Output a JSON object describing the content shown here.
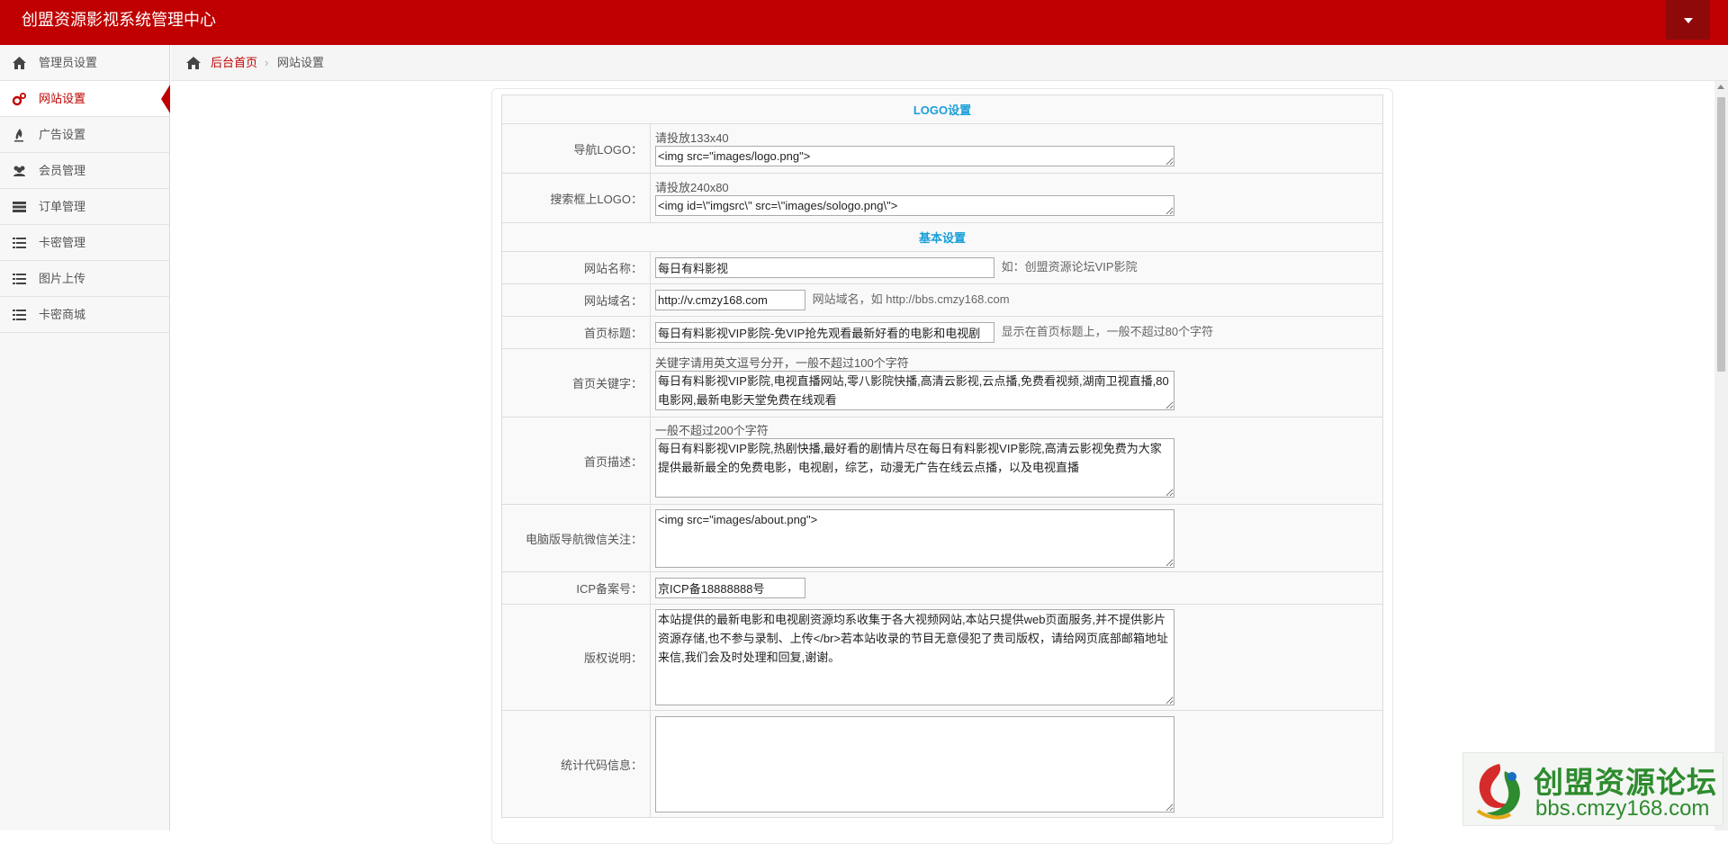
{
  "app": {
    "title": "创盟资源影视系统管理中心"
  },
  "sidebar": {
    "items": [
      {
        "label": "管理员设置",
        "icon": "home-icon"
      },
      {
        "label": "网站设置",
        "icon": "gears-icon",
        "active": true
      },
      {
        "label": "广告设置",
        "icon": "fire-icon"
      },
      {
        "label": "会员管理",
        "icon": "users-icon"
      },
      {
        "label": "订单管理",
        "icon": "server-icon"
      },
      {
        "label": "卡密管理",
        "icon": "list-icon"
      },
      {
        "label": "图片上传",
        "icon": "list-icon"
      },
      {
        "label": "卡密商城",
        "icon": "list-icon"
      }
    ]
  },
  "breadcrumb": {
    "home": "后台首页",
    "separator": "›",
    "current": "网站设置"
  },
  "form": {
    "section_logo": "LOGO设置",
    "section_basic": "基本设置",
    "nav_logo": {
      "label": "导航LOGO：",
      "hint": "请投放133x40",
      "value": "<img src=\"images/logo.png\">"
    },
    "search_logo": {
      "label": "搜索框上LOGO：",
      "hint": "请投放240x80",
      "value": "<img id=\\\"imgsrc\\\" src=\\\"images/sologo.png\\\">"
    },
    "site_name": {
      "label": "网站名称：",
      "value": "每日有料影视",
      "hint": "如：创盟资源论坛VIP影院"
    },
    "site_domain": {
      "label": "网站域名：",
      "value": "http://v.cmzy168.com",
      "hint": "网站域名，如 http://bbs.cmzy168.com"
    },
    "home_title": {
      "label": "首页标题：",
      "value": "每日有料影视VIP影院-免VIP抢先观看最新好看的电影和电视剧",
      "hint": "显示在首页标题上，一般不超过80个字符"
    },
    "home_keywords": {
      "label": "首页关键字：",
      "hint": "关键字请用英文逗号分开，一般不超过100个字符",
      "value": "每日有料影视VIP影院,电视直播网站,零八影院快播,高清云影视,云点播,免费看视频,湖南卫视直播,80电影网,最新电影天堂免费在线观看"
    },
    "home_desc": {
      "label": "首页描述：",
      "hint": "一般不超过200个字符",
      "value": "每日有料影视VIP影院,热剧快播,最好看的剧情片尽在每日有料影视VIP影院,高清云影视免费为大家提供最新最全的免费电影，电视剧，综艺，动漫无广告在线云点播，以及电视直播"
    },
    "wechat": {
      "label": "电脑版导航微信关注：",
      "value": "<img src=\"images/about.png\">"
    },
    "icp": {
      "label": "ICP备案号：",
      "value": "京ICP备18888888号"
    },
    "copyright": {
      "label": "版权说明：",
      "value": "本站提供的最新电影和电视剧资源均系收集于各大视频网站,本站只提供web页面服务,并不提供影片资源存储,也不参与录制、上传</br>若本站收录的节目无意侵犯了贵司版权，请给网页底部邮箱地址来信,我们会及时处理和回复,谢谢。"
    },
    "stats": {
      "label": "统计代码信息：",
      "value": ""
    }
  },
  "watermark": {
    "title": "创盟资源论坛",
    "url": "bbs.cmzy168.com"
  },
  "colors": {
    "brand": "#c00000",
    "section_title": "#1a9fd8"
  }
}
